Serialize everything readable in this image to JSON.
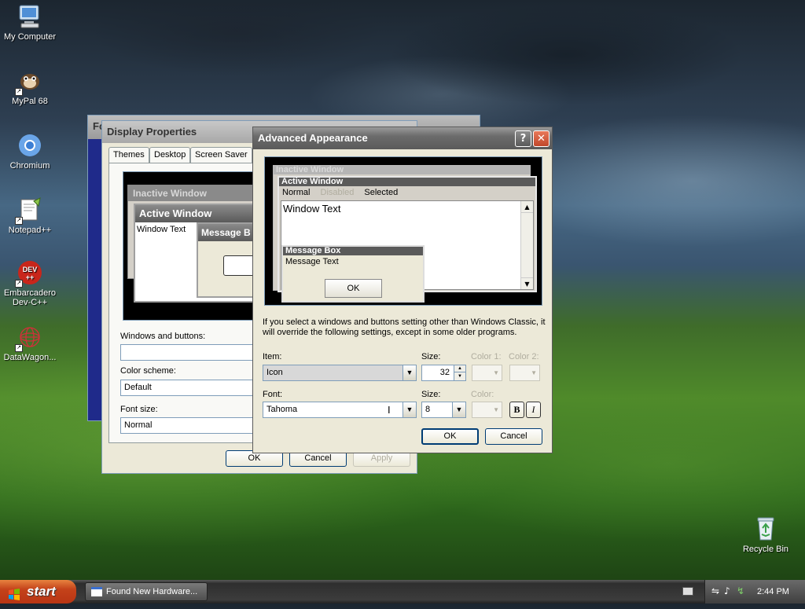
{
  "desktop": {
    "icons": [
      {
        "label": "My Computer"
      },
      {
        "label": "MyPal 68"
      },
      {
        "label": "Chromium"
      },
      {
        "label": "Notepad++"
      },
      {
        "label": "Embarcadero Dev-C++",
        "badge": "DEV"
      },
      {
        "label": "DataWagon..."
      },
      {
        "label": "Recycle Bin"
      }
    ]
  },
  "bg_window": {
    "title_fragment": "Fo"
  },
  "display_properties": {
    "title": "Display Properties",
    "tabs": [
      "Themes",
      "Desktop",
      "Screen Saver"
    ],
    "preview": {
      "inactive_title": "Inactive Window",
      "active_title": "Active Window",
      "window_text": "Window Text",
      "message_title": "Message B"
    },
    "windows_buttons_label": "Windows and buttons:",
    "windows_buttons_value": "",
    "color_scheme_label": "Color scheme:",
    "color_scheme_value": "Default",
    "font_size_label": "Font size:",
    "font_size_value": "Normal",
    "ok": "OK",
    "cancel": "Cancel",
    "apply": "Apply"
  },
  "advanced_appearance": {
    "title": "Advanced Appearance",
    "help_glyph": "?",
    "close_glyph": "✕",
    "preview": {
      "inactive_title": "Inactive Window",
      "active_title": "Active Window",
      "menu_normal": "Normal",
      "menu_disabled": "Disabled",
      "menu_selected": "Selected",
      "window_text": "Window Text",
      "message_box_title": "Message Box",
      "message_text": "Message Text",
      "ok": "OK"
    },
    "note": "If you select a windows and buttons setting other than Windows Classic, it will override the following settings, except in some older programs.",
    "item_label": "Item:",
    "item_value": "Icon",
    "size_label": "Size:",
    "size_value": "32",
    "color1_label": "Color 1:",
    "color2_label": "Color 2:",
    "font_label": "Font:",
    "font_value": "Tahoma",
    "font_size_label": "Size:",
    "font_size_value": "8",
    "font_color_label": "Color:",
    "bold_glyph": "B",
    "italic_glyph": "I",
    "ok": "OK",
    "cancel": "Cancel"
  },
  "taskbar": {
    "start_label": "start",
    "task_label": "Found New Hardware...",
    "clock": "2:44 PM"
  },
  "colors": {
    "accent_selected": "#316ac5",
    "classic_title_active": "#5a5a5a",
    "classic_title_inactive": "#b5b5b5"
  }
}
